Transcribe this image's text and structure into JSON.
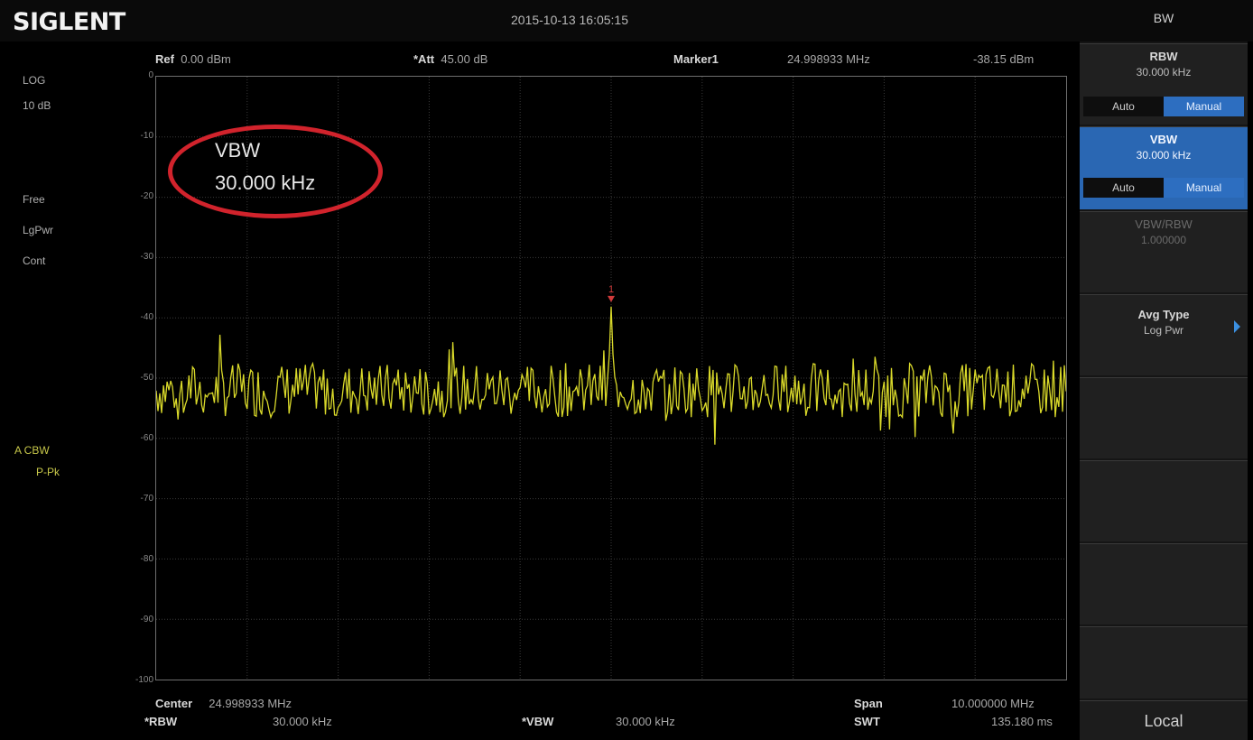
{
  "app": {
    "brand": "SIGLENT",
    "datetime": "2015-10-13  16:05:15",
    "menu_title": "BW"
  },
  "header": {
    "ref_label": "Ref",
    "ref_value": "0.00 dBm",
    "att_label": "*Att",
    "att_value": "45.00 dB",
    "marker_label": "Marker1",
    "marker_freq": "24.998933 MHz",
    "marker_level": "-38.15 dBm"
  },
  "left_panel": {
    "scale": "LOG",
    "div": "10 dB",
    "detector": "Free",
    "avg": "LgPwr",
    "sweep": "Cont",
    "trace_label": "A CBW",
    "trace_mode": "P-Pk"
  },
  "plot": {
    "y_ticks": [
      "0",
      "-10",
      "-20",
      "-30",
      "-40",
      "-50",
      "-60",
      "-70",
      "-80",
      "-90",
      "-100"
    ],
    "y_range": [
      -100,
      0
    ],
    "marker_tag": "1",
    "trace_color": "#d9d92a",
    "grid_color": "#3a3a3a",
    "marker_color": "#d23b3b"
  },
  "popup": {
    "label": "VBW",
    "value": "30.000  kHz",
    "highlight_color": "#d1232c"
  },
  "footer": {
    "center_label": "Center",
    "center_value": "24.998933  MHz",
    "span_label": "Span",
    "span_value": "10.000000  MHz",
    "rbw_label": "*RBW",
    "rbw_value": "30.000  kHz",
    "vbw_label": "*VBW",
    "vbw_value": "30.000  kHz",
    "swt_label": "SWT",
    "swt_value": "135.180  ms"
  },
  "softkeys": {
    "rbw": {
      "title": "RBW",
      "value": "30.000  kHz",
      "auto": "Auto",
      "manual": "Manual"
    },
    "vbw": {
      "title": "VBW",
      "value": "30.000  kHz",
      "auto": "Auto",
      "manual": "Manual"
    },
    "ratio": {
      "title": "VBW/RBW",
      "value": "1.000000"
    },
    "avg_type": {
      "title": "Avg Type",
      "value": "Log Pwr"
    },
    "local": "Local"
  }
}
